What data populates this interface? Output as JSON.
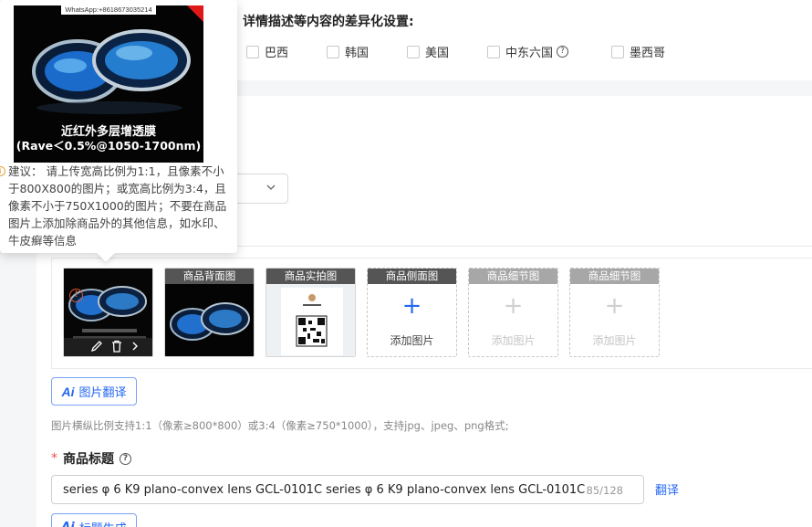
{
  "differentiation": {
    "title": "详情描述等内容的差异化设置:",
    "countries": [
      "巴西",
      "韩国",
      "美国",
      "中东六国",
      "墨西哥"
    ],
    "help_icon": "question-circle-icon"
  },
  "image_slots": [
    {
      "header": "",
      "state": "filled-main"
    },
    {
      "header": "商品背面图",
      "state": "filled"
    },
    {
      "header": "商品实拍图",
      "state": "filled-qr"
    },
    {
      "header": "商品侧面图",
      "state": "empty-active",
      "add_label": "添加图片"
    },
    {
      "header": "商品细节图",
      "state": "empty-disabled",
      "add_label": "添加图片"
    },
    {
      "header": "商品细节图",
      "state": "empty-disabled",
      "add_label": "添加图片"
    }
  ],
  "slot_toolbar": {
    "edit_icon": "pencil-icon",
    "delete_icon": "trash-icon",
    "next_icon": "chevron-right-icon"
  },
  "image_translate_button": {
    "ai": "Ai",
    "label": "图片翻译"
  },
  "image_hint": "图片横纵比例支持1:1（像素≥800*800）或3:4（像素≥750*1000），支持jpg、jpeg、png格式;",
  "product_title": {
    "required_mark": "*",
    "label": "商品标题",
    "value": "series φ 6 K9 plano-convex lens GCL-0101C series φ 6 K9 plano-convex lens GCL-0101C",
    "count": "85/128",
    "translate": "翻译"
  },
  "title_generate_button": {
    "ai": "Ai",
    "label": "标题生成"
  },
  "popover": {
    "watermark": "WhatsApp:+8618673035214",
    "caption1": "近红外多层增透膜",
    "caption2": "(Rave＜0.5%@1050-1700nm)",
    "text": "建议： 请上传宽高比例为1:1，且像素不小于800X800的图片；或宽高比例为3:4，且像素不小于750X1000的图片；不要在商品图片上添加除商品外的其他信息，如水印、牛皮癣等信息"
  },
  "colors": {
    "accent": "#2468f2",
    "required": "#f04d4d",
    "warning": "#e8542a"
  }
}
